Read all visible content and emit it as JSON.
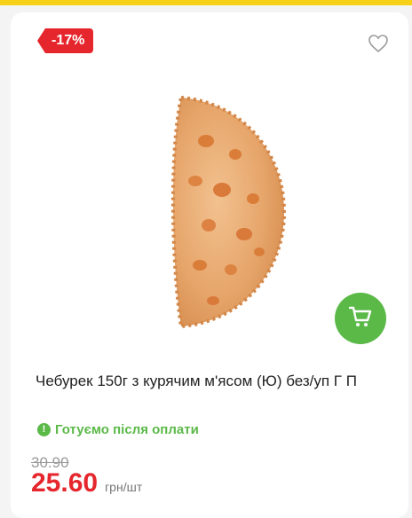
{
  "product": {
    "discount_badge": "-17%",
    "title": "Чебурек 150г з курячим м'ясом (Ю) без/уп Г П",
    "status_text": "Готуємо після оплати",
    "old_price": "30.90",
    "price": "25.60",
    "price_unit": "грн/шт",
    "image_icon": "chebureck-image",
    "favorite_icon": "heart-outline-icon",
    "cart_icon": "shopping-cart-icon"
  },
  "colors": {
    "accent_red": "#e5262c",
    "accent_green": "#5bb948",
    "top_strip": "#f7d117"
  }
}
